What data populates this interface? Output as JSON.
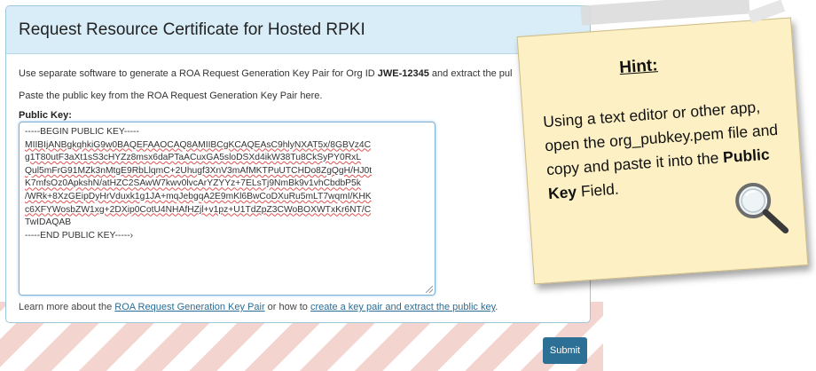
{
  "page": {
    "title": "Request Resource Certificate for Hosted RPKI"
  },
  "instructions": {
    "intro_prefix": "Use separate software to generate a ROA Request Generation Key Pair for Org ID ",
    "org_id": "JWE-12345",
    "intro_suffix": " and extract the pul",
    "paste_text": "Paste the public key from the ROA Request Generation Key Pair here."
  },
  "form": {
    "public_key_label": "Public Key:",
    "public_key_lines": [
      "-----BEGIN PUBLIC KEY-----",
      "MIIBIjANBgkqhkiG9w0BAQEFAAOCAQ8AMIIBCgKCAQEAsC9hlyNXAT5x/8GBVz4C",
      "g1T80utF3aXt1sS3cHYZz8msx6daPTaACuxGA5sloDSXd4ikW38Tu8CkSyPY0RxL",
      "Qul5mFrG91MZk3nMtgE9RbLlqmC+2Uhugf3XnV3mAfMKTPuUTCHDo8ZgQgH/HJ0t",
      "K7mfsOz0ApkshN/atHZC2SAwW7kwv0lvcArYZYYz+7ELsTj9NmBk9v1vhCbdbP5k",
      "/WRk+8XzGEipDyHrVduxk1g1JA+mqJebgqA2E9mKl6BwCoDXuRu5mLT7wqmI/KHK",
      "c6XFYWosbZW1xg+2DXip0CotU4NHAfHZjl+v1pz+U1TdZpZ3CWoBOXWTxKr6NT/C",
      "TwIDAQAB",
      "-----END PUBLIC KEY-----›"
    ],
    "learn_prefix": "Learn more about the ",
    "learn_link1": "ROA Request Generation Key Pair",
    "learn_mid": " or how to ",
    "learn_link2": "create a key pair and extract the public key",
    "learn_suffix": ".",
    "submit_label": "Submit"
  },
  "hint": {
    "title": "Hint:",
    "body_prefix": "Using a text editor or other app, open the org_pubkey.pem file and copy and paste it into the ",
    "body_bold": "Public Key",
    "body_suffix": " Field.",
    "icon": "magnifier-icon"
  },
  "colors": {
    "header_bg": "#d8edf7",
    "accent": "#2c7095",
    "note_bg": "#fcf0c4",
    "stripe": "#f3d4cf"
  }
}
